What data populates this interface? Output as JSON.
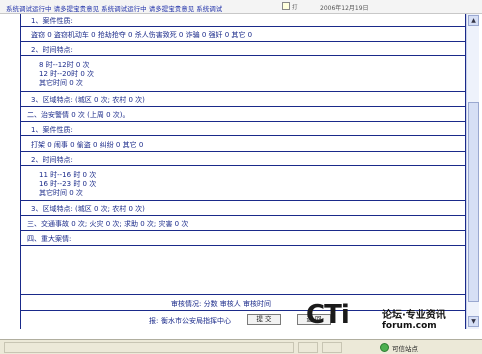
{
  "topbar": {
    "marquee": "系统调试运行中 请多提宝贵意见 系统调试运行中 请多提宝贵意见 系统调试",
    "icon_label": "打",
    "date": "2006年12月19日"
  },
  "report": {
    "s1_item1": "1、案件性质:",
    "s1_item1_values": "盗窃 0   盗窃机动车 0   抢劫抢夺 0   杀人伤害致死 0   诈骗 0   强奸 0   其它 0",
    "s1_item2": "2、时间特点:",
    "s1_times": [
      "8 时--12时 0 次",
      "12 时--20时 0 次",
      "其它时间 0 次"
    ],
    "s1_item3": "3、区域特点: (城区 0 次; 农村 0 次)",
    "s2_title": "二、治安警情 0 次 (上周 0 次)。",
    "s2_item1": "1、案件性质:",
    "s2_item1_values": "打架 0   闹事 0   偷盗 0   纠纷 0   其它 0",
    "s2_item2": "2、时间特点:",
    "s2_times": [
      "11 时--16 时 0 次",
      "16 时--23 时 0 次",
      "其它时间 0 次"
    ],
    "s2_item3": "3、区域特点: (城区 0 次; 农村 0 次)",
    "s3_title": "三、交通事故 0 次;   火灾 0 次;   求助 0 次;   灾害 0 次",
    "s4_title": "四、重大案情:",
    "review": "审核情况: 分数 审核人 审核时间",
    "report_label": "报:",
    "report_unit": "衡水市公安局指挥中心",
    "submit_label": "提 交",
    "back_label": "返 回"
  },
  "status": {
    "trusted": "可信站点"
  },
  "watermark": {
    "brand": "CTi",
    "cn": "论坛·专业资讯",
    "url": "forum.com"
  }
}
